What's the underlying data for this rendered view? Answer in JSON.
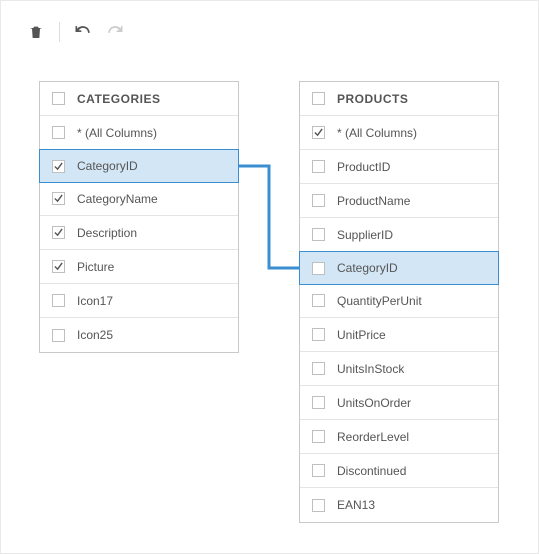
{
  "toolbar": {
    "delete": "Delete",
    "undo": "Undo",
    "redo": "Redo"
  },
  "tables": {
    "categories": {
      "title": "CATEGORIES",
      "columns": [
        {
          "label": "* (All Columns)",
          "checked": false,
          "selected": false
        },
        {
          "label": "CategoryID",
          "checked": true,
          "selected": true
        },
        {
          "label": "CategoryName",
          "checked": true,
          "selected": false
        },
        {
          "label": "Description",
          "checked": true,
          "selected": false
        },
        {
          "label": "Picture",
          "checked": true,
          "selected": false
        },
        {
          "label": "Icon17",
          "checked": false,
          "selected": false
        },
        {
          "label": "Icon25",
          "checked": false,
          "selected": false
        }
      ]
    },
    "products": {
      "title": "PRODUCTS",
      "columns": [
        {
          "label": "* (All Columns)",
          "checked": true,
          "selected": false
        },
        {
          "label": "ProductID",
          "checked": false,
          "selected": false
        },
        {
          "label": "ProductName",
          "checked": false,
          "selected": false
        },
        {
          "label": "SupplierID",
          "checked": false,
          "selected": false
        },
        {
          "label": "CategoryID",
          "checked": false,
          "selected": true
        },
        {
          "label": "QuantityPerUnit",
          "checked": false,
          "selected": false
        },
        {
          "label": "UnitPrice",
          "checked": false,
          "selected": false
        },
        {
          "label": "UnitsInStock",
          "checked": false,
          "selected": false
        },
        {
          "label": "UnitsOnOrder",
          "checked": false,
          "selected": false
        },
        {
          "label": "ReorderLevel",
          "checked": false,
          "selected": false
        },
        {
          "label": "Discontinued",
          "checked": false,
          "selected": false
        },
        {
          "label": "EAN13",
          "checked": false,
          "selected": false
        }
      ]
    }
  },
  "relation": {
    "from": "categories.CategoryID",
    "to": "products.CategoryID",
    "color": "#3b8fd1"
  }
}
